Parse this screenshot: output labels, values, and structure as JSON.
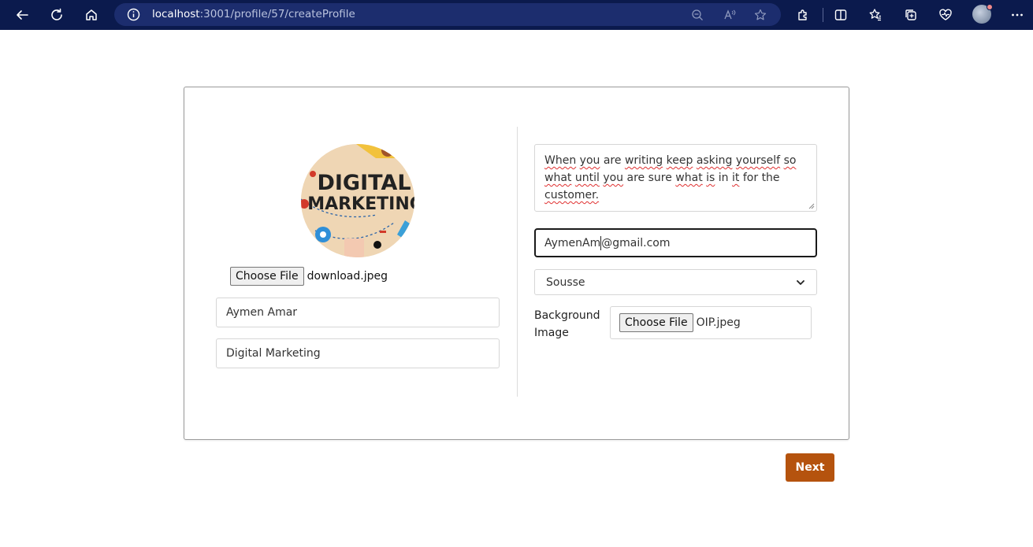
{
  "browser": {
    "url_host": "localhost",
    "url_path": ":3001/profile/57/createProfile"
  },
  "form": {
    "profile_image_name": "download.jpeg",
    "profile_image_text": [
      "DIGITAL",
      "MARKETING"
    ],
    "choose_file_label": "Choose File",
    "full_name": "Aymen Amar",
    "profession": "Digital Marketing",
    "bio_words": [
      "When",
      "you",
      "are",
      "writing",
      "keep",
      "asking",
      "yourself",
      "so",
      "what",
      "until",
      "you",
      "are",
      "sure",
      "what",
      "is",
      "in",
      "it",
      "for",
      "the",
      "customer."
    ],
    "email_before_caret": "AymenAm",
    "email_after_caret": "@gmail.com",
    "city": "Sousse",
    "background_label_line1": "Background",
    "background_label_line2": "Image",
    "background_image_name": "OIP.jpeg",
    "next_label": "Next"
  },
  "colors": {
    "topbar": "#0b1a4d",
    "urlbar": "#1c2d6e",
    "next_button": "#b5530e",
    "spellcheck": "#e03030"
  }
}
